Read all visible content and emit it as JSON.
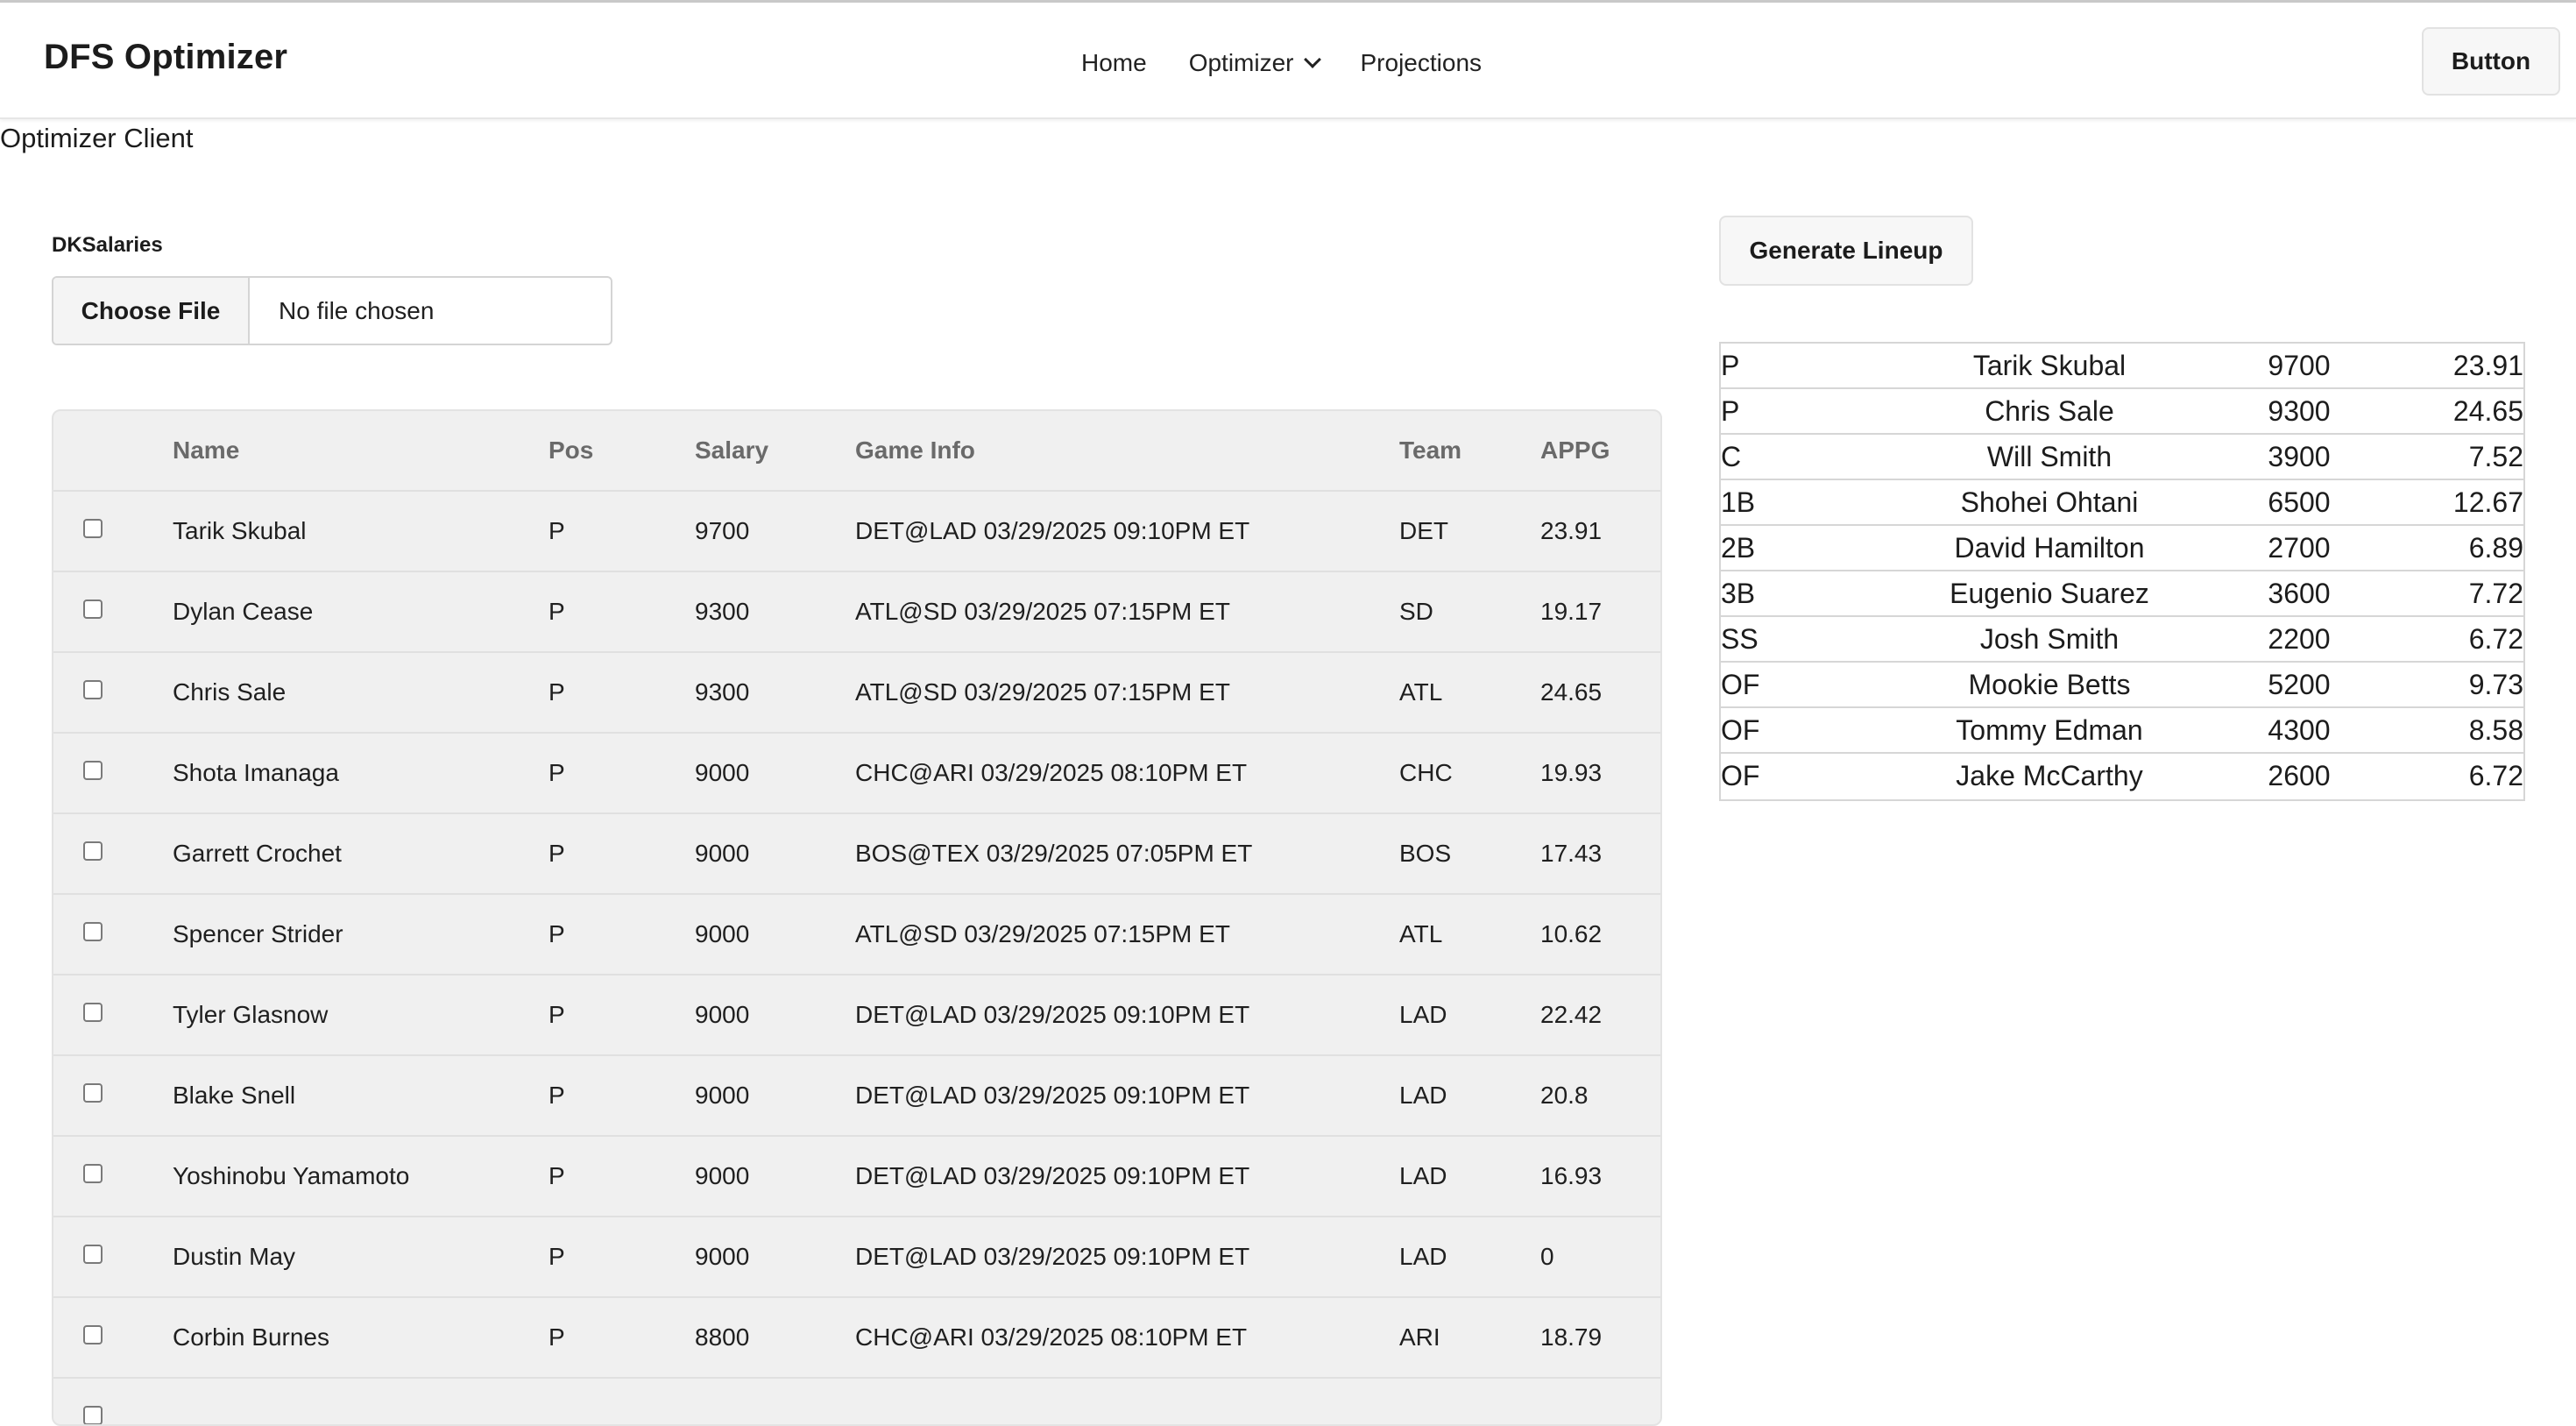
{
  "nav": {
    "brand": "DFS Optimizer",
    "links": [
      {
        "label": "Home"
      },
      {
        "label": "Optimizer",
        "has_dropdown": true,
        "icon": "chevron-down-icon"
      },
      {
        "label": "Projections"
      }
    ],
    "button_label": "Button"
  },
  "page": {
    "title": "Optimizer Client"
  },
  "upload": {
    "label": "DKSalaries",
    "choose_label": "Choose File",
    "status": "No file chosen"
  },
  "players": {
    "columns": [
      "Name",
      "Pos",
      "Salary",
      "Game Info",
      "Team",
      "APPG"
    ],
    "rows": [
      {
        "name": "Tarik Skubal",
        "pos": "P",
        "salary": "9700",
        "game": "DET@LAD 03/29/2025 09:10PM ET",
        "team": "DET",
        "appg": "23.91"
      },
      {
        "name": "Dylan Cease",
        "pos": "P",
        "salary": "9300",
        "game": "ATL@SD 03/29/2025 07:15PM ET",
        "team": "SD",
        "appg": "19.17"
      },
      {
        "name": "Chris Sale",
        "pos": "P",
        "salary": "9300",
        "game": "ATL@SD 03/29/2025 07:15PM ET",
        "team": "ATL",
        "appg": "24.65"
      },
      {
        "name": "Shota Imanaga",
        "pos": "P",
        "salary": "9000",
        "game": "CHC@ARI 03/29/2025 08:10PM ET",
        "team": "CHC",
        "appg": "19.93"
      },
      {
        "name": "Garrett Crochet",
        "pos": "P",
        "salary": "9000",
        "game": "BOS@TEX 03/29/2025 07:05PM ET",
        "team": "BOS",
        "appg": "17.43"
      },
      {
        "name": "Spencer Strider",
        "pos": "P",
        "salary": "9000",
        "game": "ATL@SD 03/29/2025 07:15PM ET",
        "team": "ATL",
        "appg": "10.62"
      },
      {
        "name": "Tyler Glasnow",
        "pos": "P",
        "salary": "9000",
        "game": "DET@LAD 03/29/2025 09:10PM ET",
        "team": "LAD",
        "appg": "22.42"
      },
      {
        "name": "Blake Snell",
        "pos": "P",
        "salary": "9000",
        "game": "DET@LAD 03/29/2025 09:10PM ET",
        "team": "LAD",
        "appg": "20.8"
      },
      {
        "name": "Yoshinobu Yamamoto",
        "pos": "P",
        "salary": "9000",
        "game": "DET@LAD 03/29/2025 09:10PM ET",
        "team": "LAD",
        "appg": "16.93"
      },
      {
        "name": "Dustin May",
        "pos": "P",
        "salary": "9000",
        "game": "DET@LAD 03/29/2025 09:10PM ET",
        "team": "LAD",
        "appg": "0"
      },
      {
        "name": "Corbin Burnes",
        "pos": "P",
        "salary": "8800",
        "game": "CHC@ARI 03/29/2025 08:10PM ET",
        "team": "ARI",
        "appg": "18.79"
      }
    ]
  },
  "lineup": {
    "generate_label": "Generate Lineup",
    "rows": [
      {
        "pos": "P",
        "name": "Tarik Skubal",
        "salary": "9700",
        "points": "23.91"
      },
      {
        "pos": "P",
        "name": "Chris Sale",
        "salary": "9300",
        "points": "24.65"
      },
      {
        "pos": "C",
        "name": "Will Smith",
        "salary": "3900",
        "points": "7.52"
      },
      {
        "pos": "1B",
        "name": "Shohei Ohtani",
        "salary": "6500",
        "points": "12.67"
      },
      {
        "pos": "2B",
        "name": "David Hamilton",
        "salary": "2700",
        "points": "6.89"
      },
      {
        "pos": "3B",
        "name": "Eugenio Suarez",
        "salary": "3600",
        "points": "7.72"
      },
      {
        "pos": "SS",
        "name": "Josh Smith",
        "salary": "2200",
        "points": "6.72"
      },
      {
        "pos": "OF",
        "name": "Mookie Betts",
        "salary": "5200",
        "points": "9.73"
      },
      {
        "pos": "OF",
        "name": "Tommy Edman",
        "salary": "4300",
        "points": "8.58"
      },
      {
        "pos": "OF",
        "name": "Jake McCarthy",
        "salary": "2600",
        "points": "6.72"
      }
    ]
  }
}
